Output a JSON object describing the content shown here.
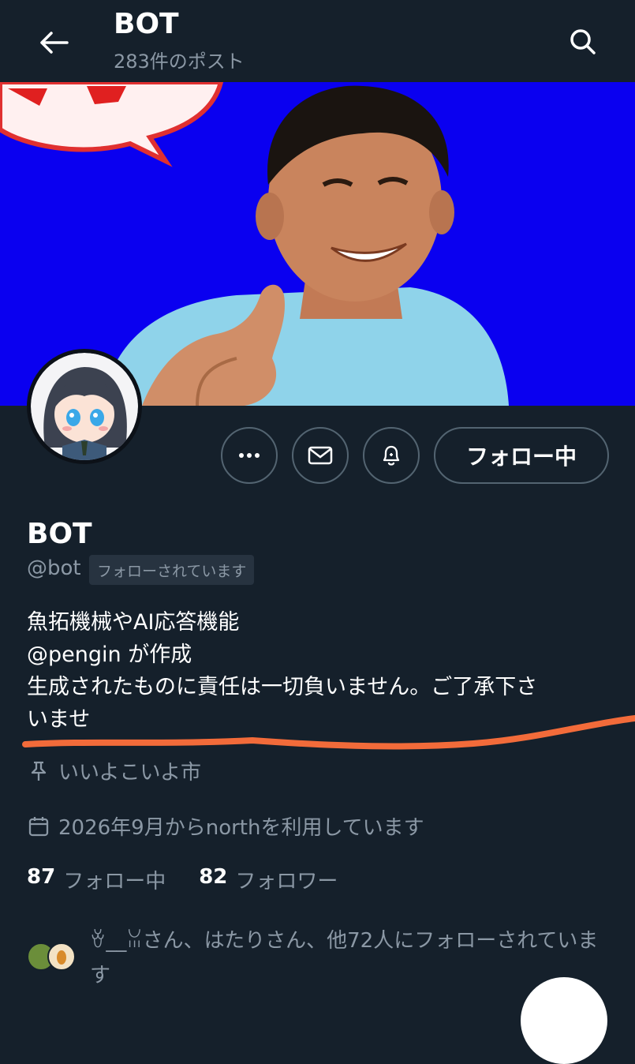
{
  "header": {
    "title": "BOT",
    "post_count": "283件のポスト"
  },
  "icons": {
    "back": "arrow-left-icon",
    "search": "search-icon",
    "more": "more-horizontal-icon",
    "message": "envelope-icon",
    "notify": "bell-icon",
    "location": "pin-icon",
    "joined": "calendar-icon"
  },
  "colors": {
    "background": "#15202b",
    "banner": "#0a00f0",
    "muted_text": "#8b98a5",
    "underline_annotation": "#f26b3a"
  },
  "actions": {
    "follow_label": "フォロー中"
  },
  "profile": {
    "name": "BOT",
    "handle": "@bot",
    "follows_you_badge": "フォローされています",
    "bio": [
      "魚拓機械やAI応答機能",
      "@pengin が作成",
      "生成されたものに責任は一切負いません。ご了承下さ",
      "いませ"
    ],
    "location": "いいよこいよ市",
    "joined": "2026年9月からnorthを利用しています"
  },
  "stats": {
    "following_count": "87",
    "following_label": "フォロー中",
    "followers_count": "82",
    "followers_label": "フォロワー"
  },
  "followed_by": {
    "text": "ꈊ__ꈍさん、はたりさん、他72人にフォローされています"
  }
}
